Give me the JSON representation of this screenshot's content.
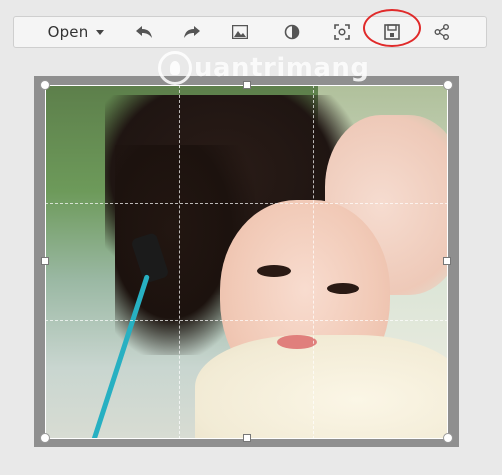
{
  "toolbar": {
    "open_label": "Open",
    "icons": [
      "undo-icon",
      "redo-icon",
      "image-icon",
      "contrast-icon",
      "focus-icon",
      "save-icon",
      "share-icon"
    ],
    "highlight_color": "#e02a2a"
  },
  "watermark": {
    "text": "uantrimang"
  },
  "editor": {
    "image_description_icon": "photo"
  }
}
